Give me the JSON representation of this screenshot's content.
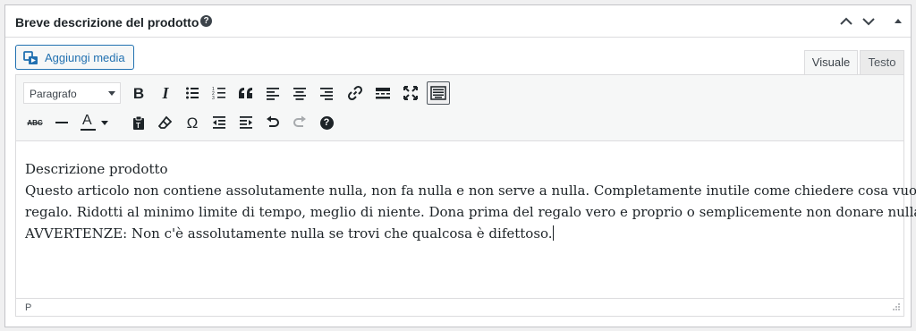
{
  "metabox": {
    "title": "Breve descrizione del prodotto",
    "help_symbol": "?"
  },
  "media_button": {
    "label": "Aggiungi media",
    "icon": "media-icon"
  },
  "tabs": [
    {
      "label": "Visuale",
      "active": true
    },
    {
      "label": "Testo",
      "active": false
    }
  ],
  "toolbar": {
    "format_select": {
      "value": "Paragrafo"
    },
    "row1": [
      "bold-icon",
      "italic-icon",
      "bullet-list-icon",
      "numbered-list-icon",
      "blockquote-icon",
      "align-left-icon",
      "align-center-icon",
      "align-right-icon",
      "link-icon",
      "read-more-icon",
      "fullscreen-icon",
      "toolbar-toggle-icon"
    ],
    "row2": [
      "strikethrough-icon",
      "horizontal-line-icon",
      "text-color-icon",
      "paste-text-icon",
      "clear-format-icon",
      "special-char-icon",
      "outdent-icon",
      "indent-icon",
      "undo-icon",
      "redo-icon",
      "help-icon"
    ],
    "bold_glyph": "B",
    "italic_glyph": "I",
    "strike_glyph": "ABC",
    "omega_glyph": "Ω",
    "text_color_glyph": "A",
    "help_glyph": "?"
  },
  "content": {
    "lines": [
      "Descrizione prodotto",
      "Questo articolo non contiene assolutamente nulla, non fa nulla e non serve a nulla. Completamente inutile come chiedere cosa vuoi in",
      "regalo. Ridotti al minimo limite di tempo, meglio di niente. Dona prima del regalo vero e proprio o semplicemente non donare nulla.",
      "AVVERTENZE: Non c'è assolutamente nulla se trovi che qualcosa è difettoso."
    ]
  },
  "statusbar": {
    "path": "P"
  }
}
